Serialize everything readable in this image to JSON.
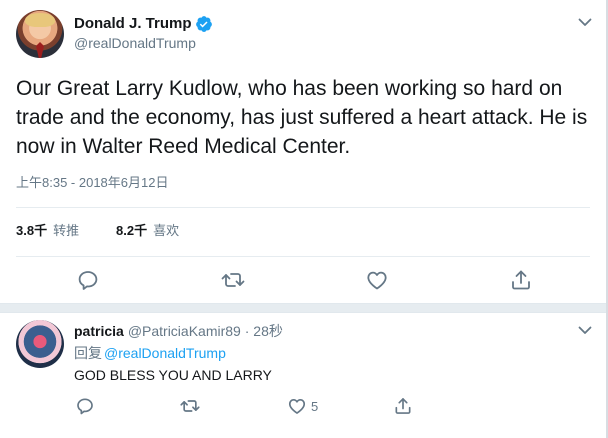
{
  "tweet": {
    "author_name": "Donald J. Trump",
    "author_handle": "@realDonaldTrump",
    "text": "Our Great Larry Kudlow, who has been working so hard on trade and the economy, has just suffered a heart attack. He is now in Walter Reed Medical Center.",
    "timestamp": "上午8:35 - 2018年6月12日",
    "retweets": "3.8千",
    "retweets_label": "转推",
    "likes": "8.2千",
    "likes_label": "喜欢"
  },
  "reply": {
    "author_name": "patricia",
    "author_handle": "@PatriciaKamir89 · 28秒",
    "reply_prefix": "回复",
    "reply_to": "@realDonaldTrump",
    "text": "GOD BLESS YOU AND LARRY",
    "like_count": "5"
  },
  "colors": {
    "accent": "#1da1f2",
    "muted": "#657786",
    "text": "#14171a",
    "divider": "#e6ecf0"
  },
  "icons": [
    "verified-badge-icon",
    "chevron-down-icon",
    "reply-icon",
    "retweet-icon",
    "like-icon",
    "share-icon"
  ]
}
